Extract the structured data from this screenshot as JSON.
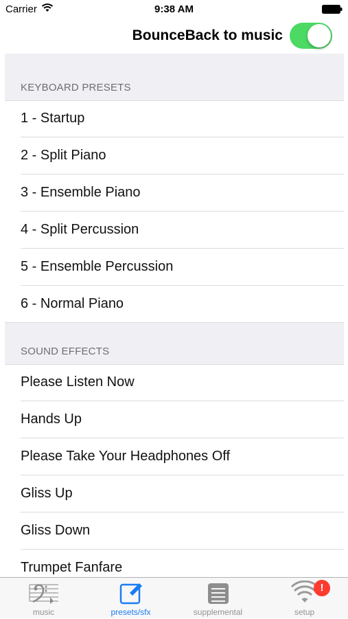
{
  "status_bar": {
    "carrier": "Carrier",
    "time": "9:38 AM"
  },
  "toggle": {
    "label": "BounceBack to music",
    "on": true,
    "color": "#4cd964"
  },
  "sections": [
    {
      "title": "KEYBOARD PRESETS",
      "items": [
        "1 - Startup",
        "2 - Split Piano",
        "3 - Ensemble Piano",
        "4 - Split Percussion",
        "5 - Ensemble Percussion",
        "6 - Normal Piano"
      ]
    },
    {
      "title": "SOUND EFFECTS",
      "items": [
        "Please Listen Now",
        "Hands Up",
        "Please Take Your Headphones Off",
        "Gliss Up",
        "Gliss Down",
        "Trumpet Fanfare"
      ]
    }
  ],
  "tab_bar": {
    "tabs": [
      {
        "label": "music",
        "icon": "bass-clef-staff-icon",
        "active": false
      },
      {
        "label": "presets/sfx",
        "icon": "compose-icon",
        "active": true
      },
      {
        "label": "supplemental",
        "icon": "list-icon",
        "active": false
      },
      {
        "label": "setup",
        "icon": "wifi-icon",
        "active": false
      }
    ],
    "badge": "!",
    "active_color": "#1a7cf5",
    "inactive_color": "#929292"
  }
}
